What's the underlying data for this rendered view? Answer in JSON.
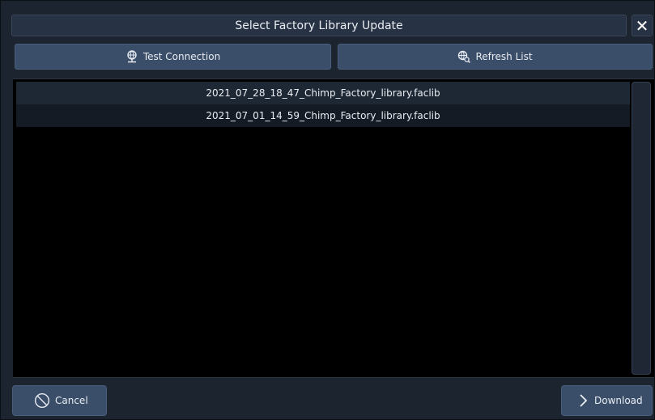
{
  "dialog": {
    "title": "Select Factory Library Update",
    "close_icon": "close-icon"
  },
  "toolbar": {
    "test_connection_label": "Test Connection",
    "test_connection_icon": "network-globe-icon",
    "refresh_list_label": "Refresh List",
    "refresh_list_icon": "globe-search-icon"
  },
  "files": [
    "2021_07_28_18_47_Chimp_Factory_library.faclib",
    "2021_07_01_14_59_Chimp_Factory_library.faclib"
  ],
  "footer": {
    "cancel_label": "Cancel",
    "cancel_icon": "cancel-circle-icon",
    "download_label": "Download",
    "download_icon": "chevron-right-icon"
  },
  "colors": {
    "panel": "#1c2430",
    "button": "#3a4d69",
    "list_background": "#000000"
  }
}
